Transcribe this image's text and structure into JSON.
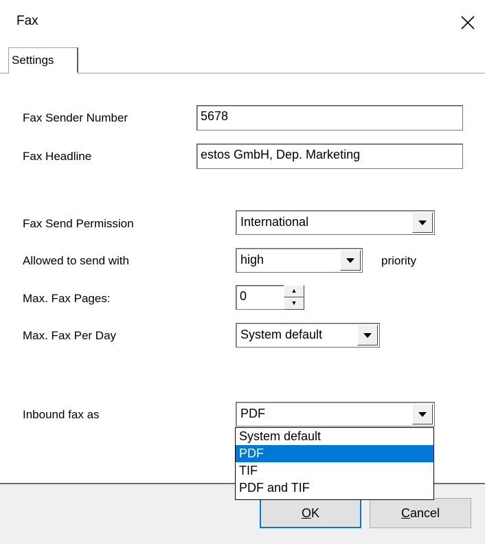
{
  "window": {
    "title": "Fax"
  },
  "tabs": [
    {
      "label": "Settings"
    }
  ],
  "form": {
    "sender_number": {
      "label": "Fax Sender Number",
      "value": "5678"
    },
    "headline": {
      "label": "Fax Headline",
      "value": "estos GmbH, Dep. Marketing"
    },
    "send_permission": {
      "label": "Fax Send Permission",
      "value": "International"
    },
    "priority": {
      "label": "Allowed to send with",
      "value": "high",
      "suffix": "priority"
    },
    "max_pages": {
      "label": "Max. Fax Pages:",
      "value": "0"
    },
    "max_per_day": {
      "label": "Max. Fax Per Day",
      "value": "System default"
    },
    "inbound_as": {
      "label": "Inbound fax as",
      "value": "PDF",
      "options": [
        "System default",
        "PDF",
        "TIF",
        "PDF and TIF"
      ],
      "selected_index": 1
    }
  },
  "buttons": {
    "ok": {
      "mnemonic": "O",
      "rest": "K"
    },
    "cancel": {
      "mnemonic": "C",
      "rest": "ancel"
    }
  },
  "colors": {
    "selection": "#0078d7",
    "footer": "#f0f0f0"
  }
}
